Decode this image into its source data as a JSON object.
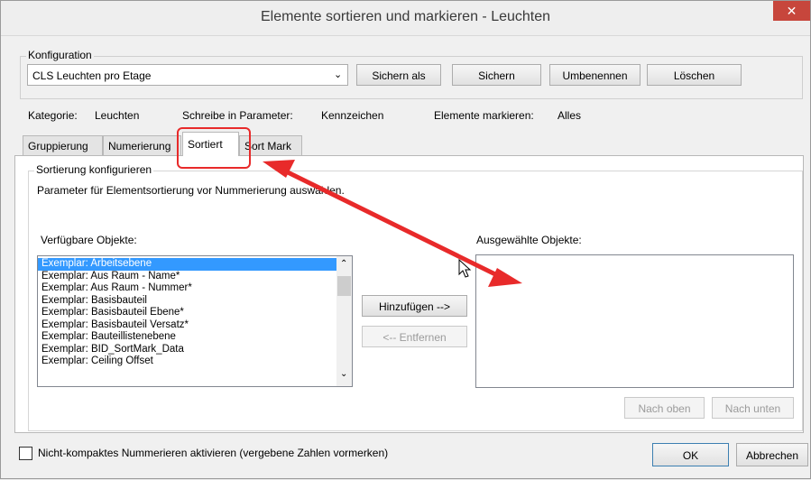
{
  "window": {
    "title": "Elemente sortieren und markieren - Leuchten",
    "close_glyph": "✕"
  },
  "config": {
    "group_label": "Konfiguration",
    "selected": "CLS Leuchten pro Etage",
    "buttons": {
      "save_as": "Sichern als",
      "save": "Sichern",
      "rename": "Umbenennen",
      "delete": "Löschen"
    }
  },
  "info": {
    "category_label": "Kategorie:",
    "category_value": "Leuchten",
    "write_label": "Schreibe in Parameter:",
    "write_value": "Kennzeichen",
    "mark_label": "Elemente markieren:",
    "mark_value": "Alles"
  },
  "tabs": [
    "Gruppierung",
    "Numerierung",
    "Sortiert",
    "Sort Mark"
  ],
  "panel": {
    "group_label": "Sortierung konfigurieren",
    "description": "Parameter für Elementsortierung vor Nummerierung auswählen.",
    "available_label": "Verfügbare Objekte:",
    "selected_label": "Ausgewählte Objekte:",
    "available_items": [
      "Exemplar: Arbeitsebene",
      "Exemplar: Aus Raum - Name*",
      "Exemplar: Aus Raum - Nummer*",
      "Exemplar: Basisbauteil",
      "Exemplar: Basisbauteil Ebene*",
      "Exemplar: Basisbauteil Versatz*",
      "Exemplar: Bauteillistenebene",
      "Exemplar: BID_SortMark_Data",
      "Exemplar: Ceiling Offset"
    ],
    "add_button": "Hinzufügen -->",
    "remove_button": "<-- Entfernen",
    "up_button": "Nach oben",
    "down_button": "Nach unten"
  },
  "footer": {
    "checkbox_label": "Nicht-kompaktes Nummerieren aktivieren (vergebene Zahlen vormerken)",
    "checkbox_checked": false,
    "ok": "OK",
    "cancel": "Abbrechen"
  },
  "annotation": {
    "color": "#e82a2a"
  }
}
